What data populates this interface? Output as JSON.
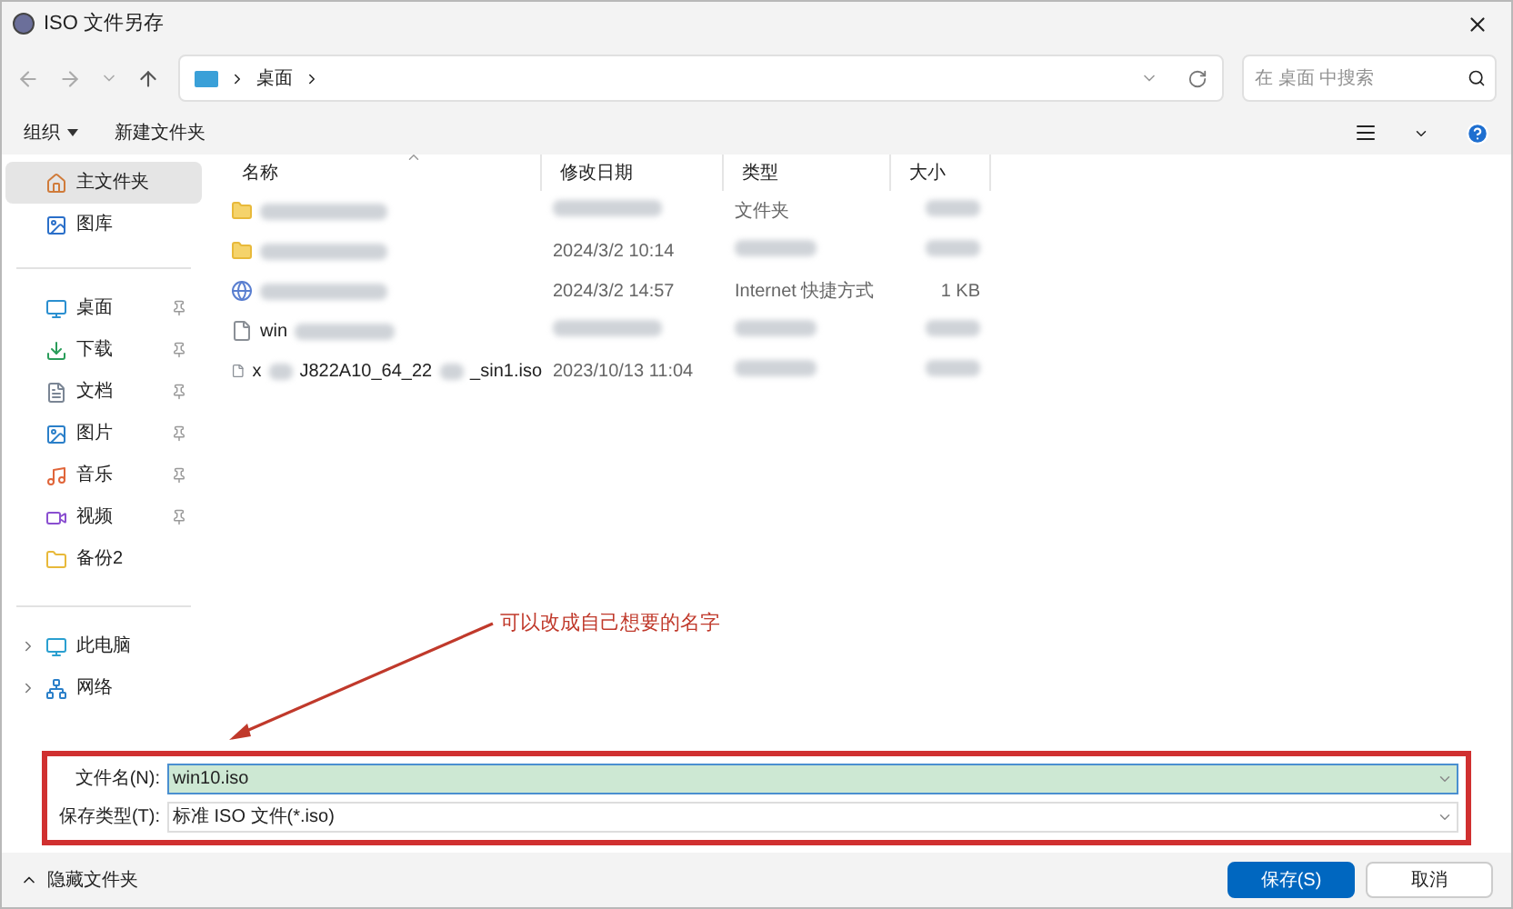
{
  "window": {
    "title": "ISO 文件另存"
  },
  "address": {
    "crumbs": [
      "桌面"
    ]
  },
  "search": {
    "placeholder": "在 桌面 中搜索"
  },
  "toolbar": {
    "organize": "组织",
    "new_folder": "新建文件夹"
  },
  "sidebar": {
    "items": [
      {
        "label": "主文件夹",
        "kind": "home",
        "selected": true,
        "pinned": false,
        "expandable": false
      },
      {
        "label": "图库",
        "kind": "gallery",
        "selected": false,
        "pinned": false,
        "expandable": false
      },
      {
        "label": "桌面",
        "kind": "desktop",
        "selected": false,
        "pinned": true,
        "expandable": false
      },
      {
        "label": "下载",
        "kind": "download",
        "selected": false,
        "pinned": true,
        "expandable": false
      },
      {
        "label": "文档",
        "kind": "document",
        "selected": false,
        "pinned": true,
        "expandable": false
      },
      {
        "label": "图片",
        "kind": "picture",
        "selected": false,
        "pinned": true,
        "expandable": false
      },
      {
        "label": "音乐",
        "kind": "music",
        "selected": false,
        "pinned": true,
        "expandable": false
      },
      {
        "label": "视频",
        "kind": "video",
        "selected": false,
        "pinned": true,
        "expandable": false
      },
      {
        "label": "备份2",
        "kind": "folder",
        "selected": false,
        "pinned": false,
        "expandable": false
      },
      {
        "label": "此电脑",
        "kind": "pc",
        "selected": false,
        "pinned": false,
        "expandable": true
      },
      {
        "label": "网络",
        "kind": "network",
        "selected": false,
        "pinned": false,
        "expandable": true
      }
    ]
  },
  "table": {
    "columns": [
      "名称",
      "修改日期",
      "类型",
      "大小"
    ],
    "rows": [
      {
        "kind": "folder",
        "name_parts": [],
        "date": "",
        "type": "文件夹",
        "size": ""
      },
      {
        "kind": "folder",
        "name_parts": [],
        "date": "2024/3/2 10:14",
        "type": "",
        "size": ""
      },
      {
        "kind": "shortcut",
        "name_parts": [],
        "date": "2024/3/2 14:57",
        "type": "Internet 快捷方式",
        "size": "1 KB"
      },
      {
        "kind": "file",
        "name_parts": [
          "win"
        ],
        "date": "",
        "type": "",
        "size": ""
      },
      {
        "kind": "file",
        "name_parts": [
          "x",
          "J822A10_64_22",
          "_sin1.iso"
        ],
        "date": "2023/10/13 11:04",
        "type": "",
        "size": ""
      }
    ]
  },
  "form": {
    "filename_label": "文件名(N):",
    "filename_value": "win10.iso",
    "type_label": "保存类型(T):",
    "type_value": "标准 ISO 文件(*.iso)"
  },
  "annotation": {
    "text": "可以改成自己想要的名字"
  },
  "footer": {
    "hide_folders": "隐藏文件夹",
    "buttons": [
      "保存(S)",
      "取消"
    ]
  }
}
